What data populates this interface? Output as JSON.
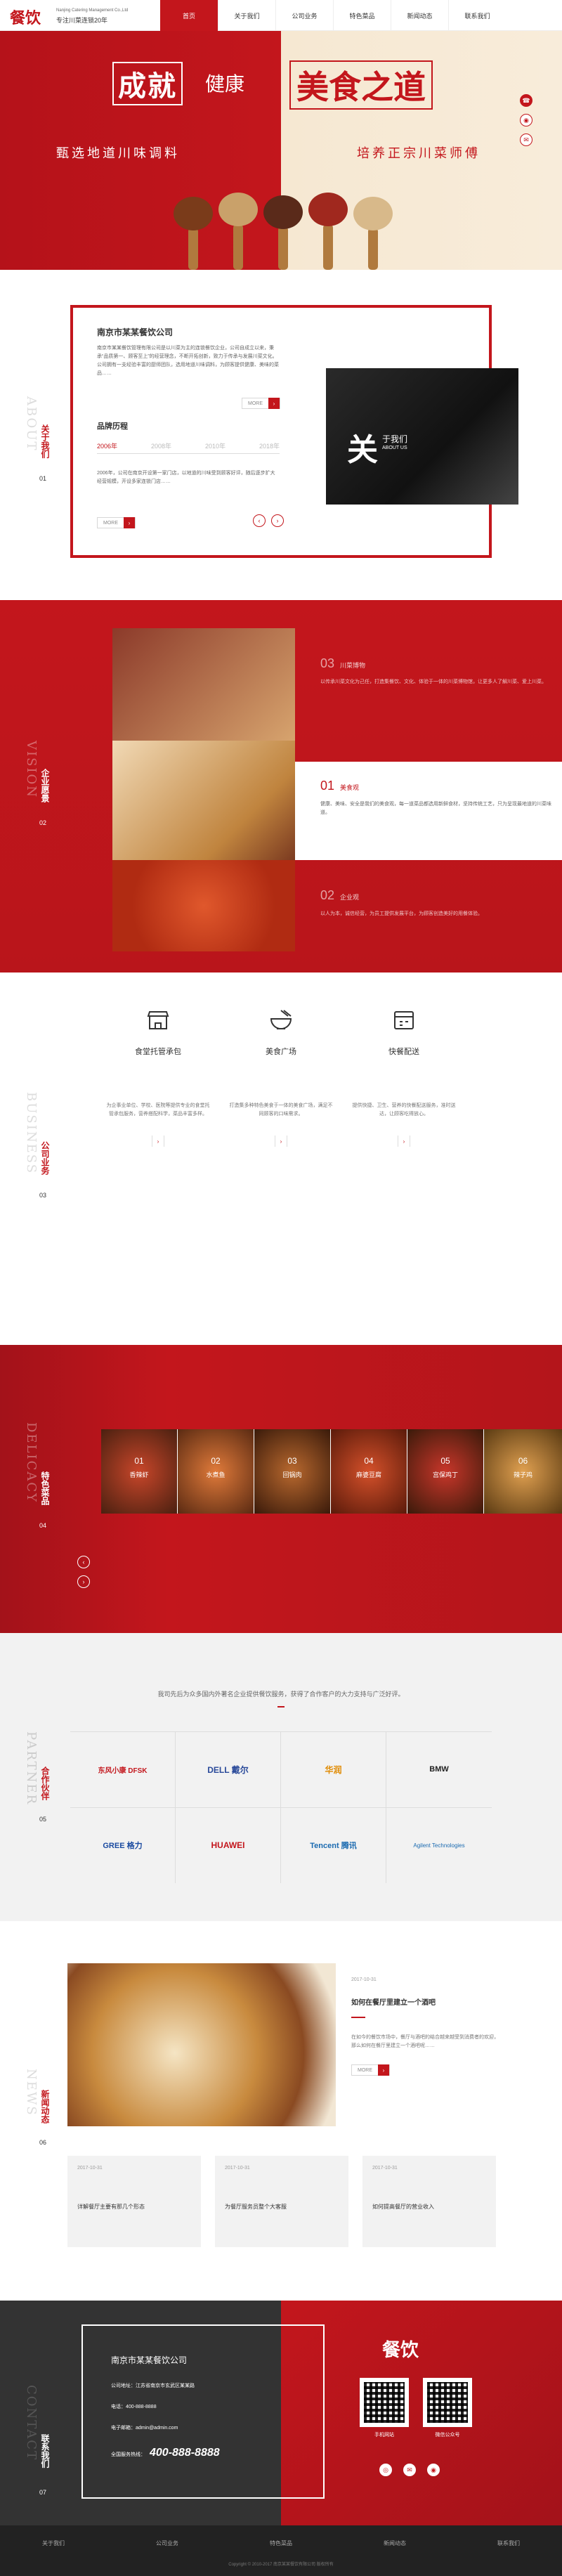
{
  "header": {
    "logo": "餐饮",
    "company_en": "Nanjing Catering Management Co.,Ltd",
    "slogan": "专注川菜连锁20年",
    "nav": [
      "首页",
      "关于我们",
      "公司业务",
      "特色菜品",
      "新闻动态",
      "联系我们"
    ]
  },
  "banner": {
    "title_a": "成就",
    "title_b": "健康",
    "title_c": "美食之道",
    "left_text": "甄选地道川味调料",
    "right_text": "培养正宗川菜师傅",
    "side_icons": [
      "phone-icon",
      "qq-icon",
      "wechat-icon"
    ],
    "colors": {
      "accent": "#c3161c",
      "cream": "#f7e9d4"
    }
  },
  "about": {
    "side_en": "ABOUT",
    "side_cn": "关于我们",
    "side_num": "01",
    "company": "南京市某某餐饮公司",
    "intro": "南京市某某餐饮管理有限公司是以川菜为主的连锁餐饮企业，公司自成立以来，秉承“品质第一、顾客至上”的经营理念，不断开拓创新，致力于传承与发展川菜文化。公司拥有一支经验丰富的厨师团队，选用地道川味调料，为顾客提供健康、美味的菜品……",
    "more": "MORE",
    "history_title": "品牌历程",
    "years": [
      "2006年",
      "2008年",
      "2010年",
      "2018年"
    ],
    "history_text": "2006年，公司在南京开设第一家门店，以地道的川味受到顾客好评，随后逐步扩大经营规模，开设多家连锁门店……",
    "big_char": "关",
    "small_cn": "于我们",
    "small_en": "ABOUT US"
  },
  "vision": {
    "side_en": "VISION",
    "side_cn": "企业愿景",
    "side_num": "02",
    "items": [
      {
        "num": "03",
        "title": "川菜博物",
        "text": "以传承川菜文化为己任，打造集餐饮、文化、体验于一体的川菜博物馆，让更多人了解川菜、爱上川菜。"
      },
      {
        "num": "01",
        "title": "美食观",
        "text": "健康、美味、安全是我们的美食观，每一道菜品都选用新鲜食材，坚持传统工艺，只为呈现最地道的川菜味道。"
      },
      {
        "num": "02",
        "title": "企业观",
        "text": "以人为本，诚信经营，为员工提供发展平台，为顾客创造美好的用餐体验。"
      }
    ]
  },
  "business": {
    "side_en": "BUSINESS",
    "side_cn": "公司业务",
    "side_num": "03",
    "items": [
      {
        "icon": "storefront-icon",
        "title": "食堂托管承包",
        "text": "为企事业单位、学校、医院等提供专业的食堂托管承包服务，营养搭配科学，菜品丰富多样。"
      },
      {
        "icon": "bowl-icon",
        "title": "美食广场",
        "text": "打造集多种特色美食于一体的美食广场，满足不同顾客的口味需求。"
      },
      {
        "icon": "delivery-icon",
        "title": "快餐配送",
        "text": "提供快捷、卫生、营养的快餐配送服务，准时送达，让顾客吃得放心。"
      }
    ]
  },
  "delicacy": {
    "side_en": "DELICACY",
    "side_cn": "特色菜品",
    "side_num": "04",
    "dishes": [
      {
        "num": "01",
        "name": "香辣虾"
      },
      {
        "num": "02",
        "name": "水煮鱼"
      },
      {
        "num": "03",
        "name": "回锅肉"
      },
      {
        "num": "04",
        "name": "麻婆豆腐"
      },
      {
        "num": "05",
        "name": "宫保鸡丁"
      },
      {
        "num": "06",
        "name": "辣子鸡"
      }
    ]
  },
  "partner": {
    "side_en": "PARTNER",
    "side_cn": "合作伙伴",
    "side_num": "05",
    "intro": "我司先后为众多国内外著名企业提供餐饮服务，获得了合作客户的大力支持与广泛好评。",
    "logos": [
      "东风小康 DFSK",
      "DELL 戴尔",
      "华润",
      "BMW",
      "GREE 格力",
      "HUAWEI",
      "Tencent 腾讯",
      "Agilent Technologies"
    ]
  },
  "news": {
    "side_en": "NEWS",
    "side_cn": "新闻动态",
    "side_num": "06",
    "featured": {
      "date": "2017-10-31",
      "title": "如何在餐厅里建立一个酒吧",
      "text": "在如今的餐饮市场中，餐厅与酒吧的结合越来越受到消费者的欢迎，那么如何在餐厅里建立一个酒吧呢……",
      "more": "MORE"
    },
    "items": [
      {
        "date": "2017-10-31",
        "title": "详解餐厅主要有那几个形态"
      },
      {
        "date": "2017-10-31",
        "title": "为餐厅服务员整个大客服"
      },
      {
        "date": "2017-10-31",
        "title": "如何提高餐厅的营业收入"
      }
    ]
  },
  "contact": {
    "side_en": "CONTACT",
    "side_cn": "联系我们",
    "side_num": "07",
    "company": "南京市某某餐饮公司",
    "address_label": "公司地址：",
    "address": "江苏省南京市玄武区某某路",
    "phone_label": "电话：",
    "phone": "400-888-8888",
    "email_label": "电子邮箱：",
    "email": "admin@admin.com",
    "hotline_label": "全国服务热线：",
    "hotline": "400-888-8888",
    "logo": "餐饮",
    "qr_labels": [
      "手机网站",
      "微信公众号"
    ]
  },
  "footer": {
    "nav": [
      "关于我们",
      "公司业务",
      "特色菜品",
      "新闻动态",
      "联系我们"
    ],
    "copyright": "Copyright © 2010-2017 南京某某餐饮有限公司 版权所有"
  }
}
